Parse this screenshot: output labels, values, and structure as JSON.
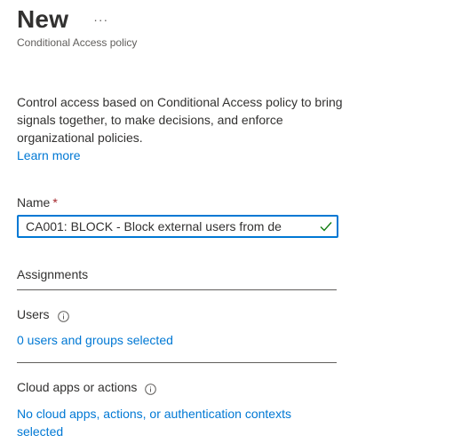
{
  "header": {
    "title": "New",
    "more_label": "···",
    "subtitle": "Conditional Access policy"
  },
  "description": {
    "text": "Control access based on Conditional Access policy to bring signals together, to make decisions, and enforce organizational policies.",
    "learn_more": "Learn more"
  },
  "name_field": {
    "label": "Name",
    "required_marker": "*",
    "value": "CA001: BLOCK - Block external users from de",
    "valid_icon": "check-icon",
    "valid_color": "#107c10"
  },
  "assignments": {
    "heading": "Assignments",
    "users": {
      "label": "Users",
      "info_icon": "info-icon",
      "value": "0 users and groups selected"
    },
    "cloud_apps": {
      "label": "Cloud apps or actions",
      "info_icon": "info-icon",
      "value": "No cloud apps, actions, or authentication contexts selected"
    }
  },
  "colors": {
    "link": "#0078d4",
    "text": "#323130",
    "secondary_text": "#605e5c",
    "required": "#a4262c",
    "focus_border": "#0078d4"
  }
}
